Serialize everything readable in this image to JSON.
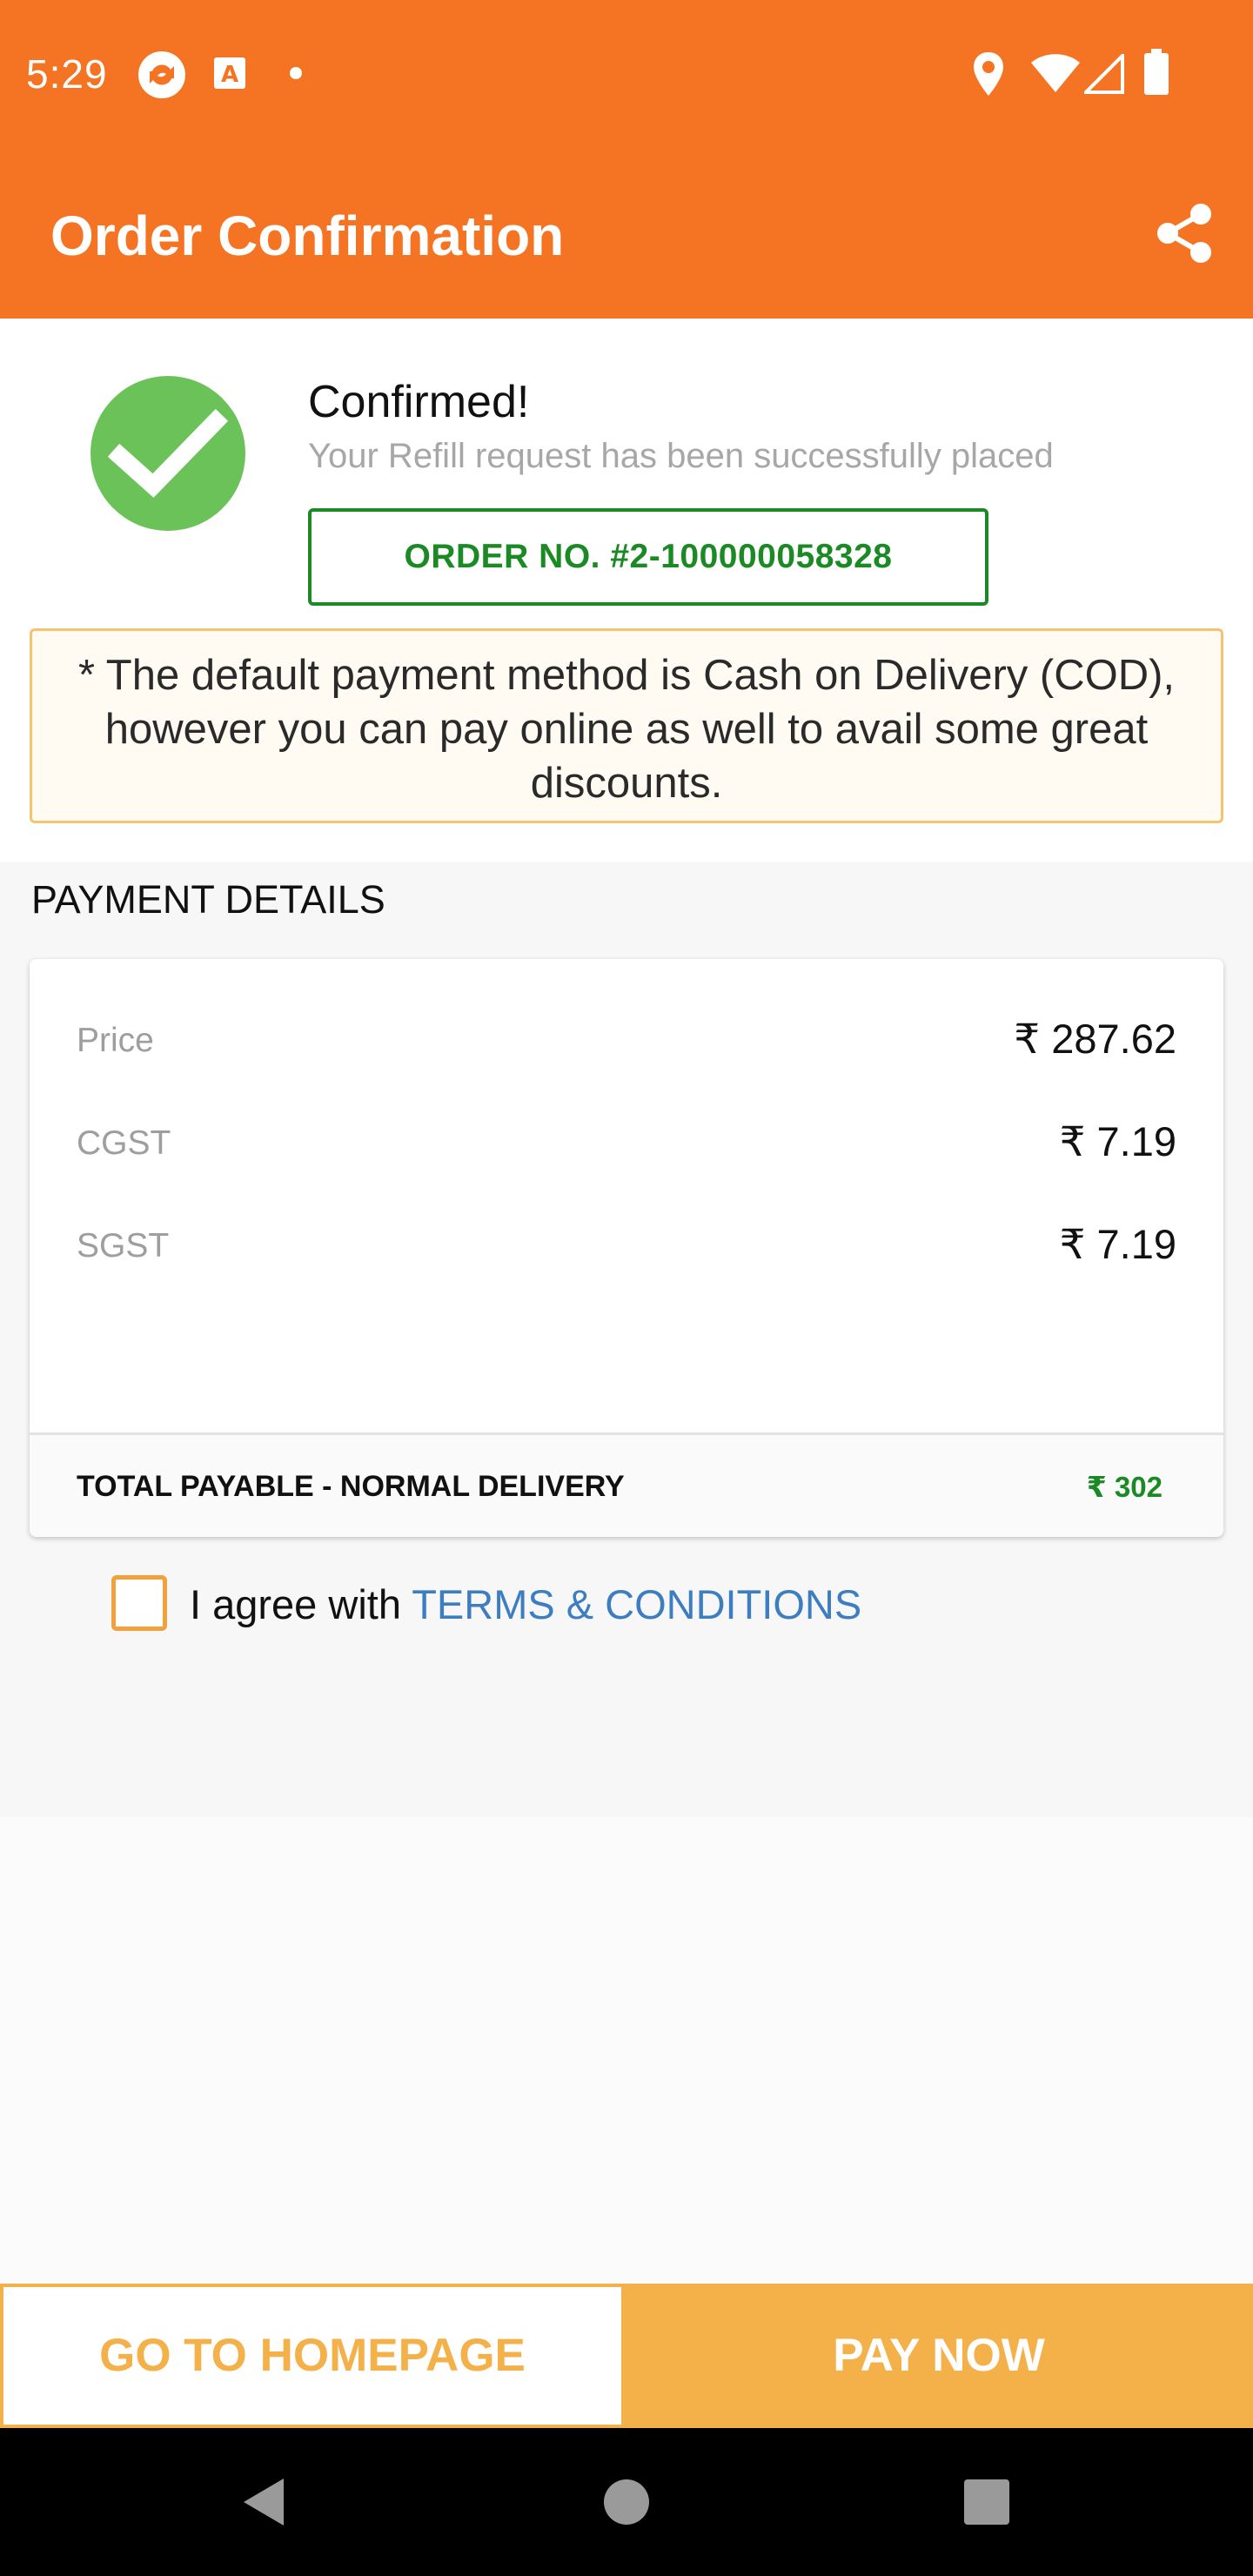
{
  "status_bar": {
    "time": "5:29",
    "icons": [
      "sync-icon",
      "text-a-icon",
      "dot-icon",
      "location-icon",
      "wifi-icon",
      "signal-icon",
      "battery-icon"
    ]
  },
  "app_bar": {
    "title": "Order Confirmation",
    "share_icon": "share-icon"
  },
  "confirmation": {
    "title": "Confirmed!",
    "subtitle": "Your Refill request has been successfully placed",
    "order_number": "ORDER NO. #2-100000058328",
    "note": "* The default payment method is Cash on Delivery (COD), however you can pay online as well to avail some great discounts."
  },
  "payment": {
    "heading": "PAYMENT DETAILS",
    "rows": [
      {
        "label": "Price",
        "value": "₹ 287.62"
      },
      {
        "label": "CGST",
        "value": "₹ 7.19"
      },
      {
        "label": "SGST",
        "value": "₹ 7.19"
      }
    ],
    "total_label": "TOTAL PAYABLE - NORMAL DELIVERY",
    "total_value": "₹ 302"
  },
  "agreement": {
    "prefix": "I agree with ",
    "link": "TERMS & CONDITIONS",
    "checked": false
  },
  "actions": {
    "home_label": "GO TO HOMEPAGE",
    "pay_label": "PAY NOW"
  },
  "colors": {
    "brand_orange": "#f47424",
    "button_amber": "#f4b14a",
    "success_green": "#1c8a24",
    "check_green": "#6ac259",
    "link_blue": "#3d7ec1"
  },
  "nav": [
    "back-icon",
    "home-icon",
    "recents-icon"
  ]
}
